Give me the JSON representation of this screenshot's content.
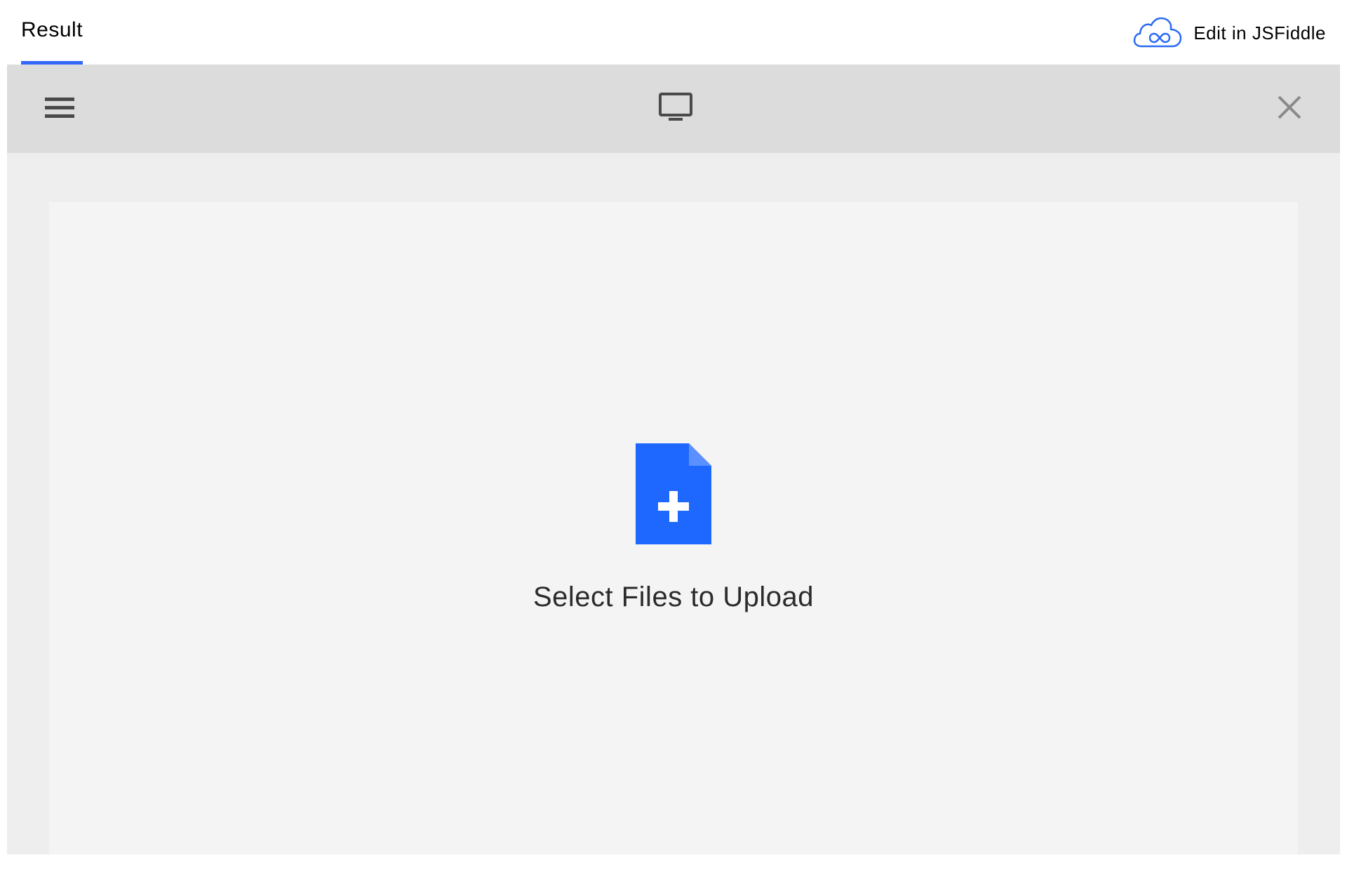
{
  "topbar": {
    "tab_label": "Result",
    "edit_label": "Edit in JSFiddle"
  },
  "upload": {
    "prompt": "Select Files to Upload"
  },
  "colors": {
    "accent": "#3267fc",
    "file_icon": "#1f68ff",
    "header_bg": "#dcdcdc",
    "content_bg": "#eeeeee",
    "panel_bg": "#f4f4f4"
  }
}
